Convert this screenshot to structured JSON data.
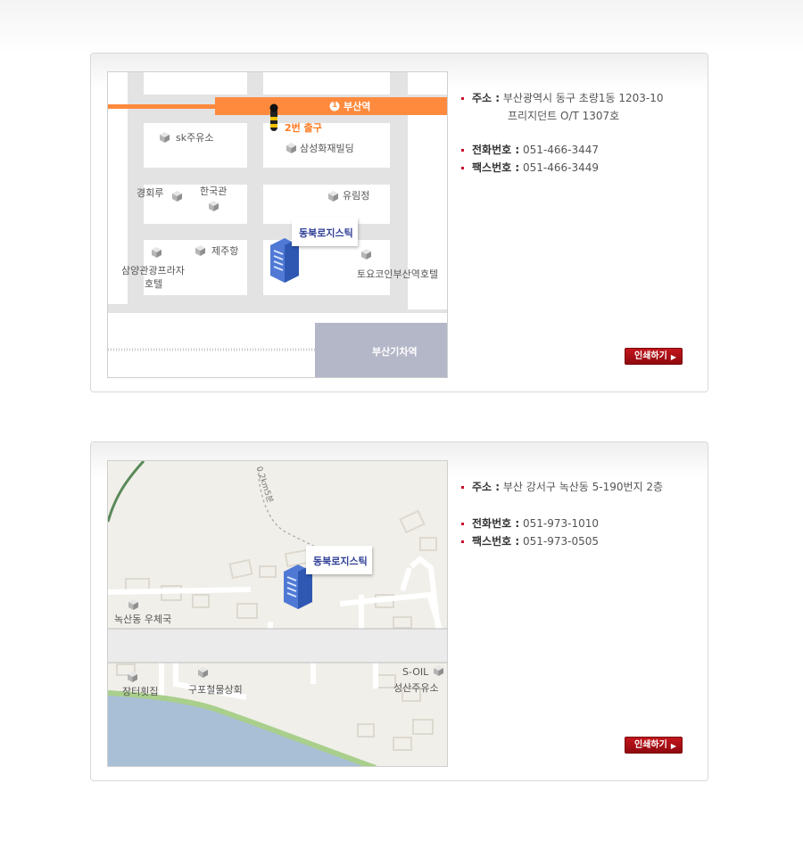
{
  "locations": [
    {
      "map": {
        "station_line_label": "부산역",
        "station_number": "1",
        "exit_label": "2번 출구",
        "landmarks": {
          "sk": "sk주유소",
          "samsung": "삼성화재빌딩",
          "gyeonghoeru": "경회루",
          "hanguk": "한국관",
          "yurim": "유림정",
          "jeju": "제주항",
          "samyang_1": "삼양관광프라자",
          "samyang_2": "호텔",
          "toyoko": "토요코인부산역호텔",
          "train_station": "부산기차역"
        },
        "company_label": "동북로지스틱"
      },
      "address_label": "주소 :",
      "address_line1": "부산광역시 동구 초량1동 1203-10",
      "address_line2": "프리지던트 O/T 1307호",
      "phone_label": "전화번호 :",
      "phone": "051-466-3447",
      "fax_label": "팩스번호 :",
      "fax": "051-466-3449",
      "print_label": "인쇄하기"
    },
    {
      "map": {
        "distance_label": "0.2km5분",
        "landmarks": {
          "post_office": "녹산동 우체국",
          "jangteo": "장터횟집",
          "gupo": "구포철물상회",
          "soil_1": "S-OIL",
          "soil_2": "성산주유소"
        },
        "company_label": "동북로지스틱"
      },
      "address_label": "주소 :",
      "address_line1": "부산 강서구 녹산동 5-190번지 2층",
      "phone_label": "전화번호 :",
      "phone": "051-973-1010",
      "fax_label": "팩스번호 :",
      "fax": "051-973-0505",
      "print_label": "인쇄하기"
    }
  ],
  "colors": {
    "accent_orange": "#ff8a3d",
    "print_red": "#b0101a",
    "bullet_red": "#c8102e",
    "station_block": "#b4b7c8",
    "water": "#a8bfd6",
    "shore_green": "#a9cf8c",
    "company_label": "#2f3f95"
  }
}
